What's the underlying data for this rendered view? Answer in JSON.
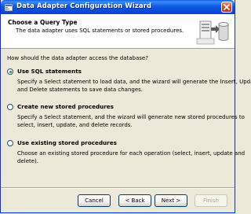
{
  "window": {
    "title": "Data Adapter Configuration Wizard"
  },
  "header": {
    "title": "Choose a Query Type",
    "subtitle": "The data adapter uses SQL statements or stored procedures."
  },
  "question": "How should the data adapter access the database?",
  "options": [
    {
      "label": "Use SQL statements",
      "checked": true,
      "desc": [
        "Specify a Select statement to load data, and the wizard will generate the Insert, Update,",
        "and Delete statements to save data changes."
      ]
    },
    {
      "label": "Create new stored procedures",
      "checked": false,
      "desc": [
        "Specify a Select statement, and the wizard will generate new stored procedures to",
        "select, insert, update, and delete records."
      ]
    },
    {
      "label": "Use existing stored procedures",
      "checked": false,
      "desc": [
        "Choose an existing stored procedure for each operation (select, insert, update and",
        "delete)."
      ]
    }
  ],
  "buttons": {
    "cancel": "Cancel",
    "back": "< Back",
    "next": "Next >",
    "finish": "Finish"
  },
  "icons": {
    "app": "wizard-app-icon",
    "header": "database-server-icon",
    "close": "close-icon"
  },
  "colors": {
    "titlebar": "#0a5ee8",
    "radio_checked": "#21a121"
  }
}
